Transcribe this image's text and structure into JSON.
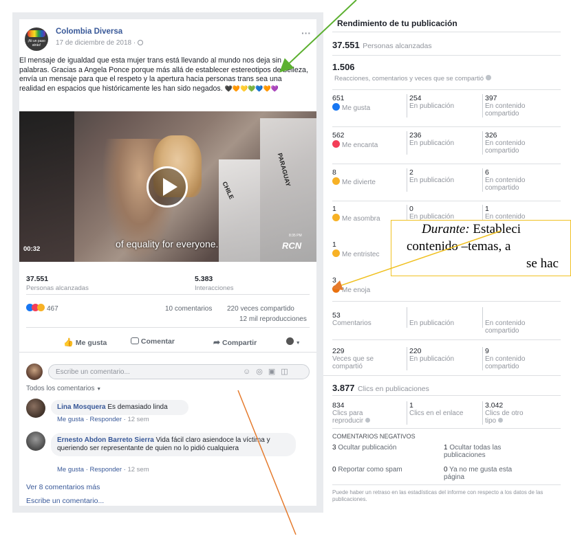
{
  "post": {
    "page_name": "Colombia Diversa",
    "avatar_text": "¡Ni un paso atrás!",
    "date": "17 de diciembre de 2018 · ",
    "more": "···",
    "text": "El mensaje de igualdad que esta mujer trans está llevando al mundo nos deja sin palabras. Gracias a Angela Ponce porque más allá de establecer estereotipos de belleza, envía un mensaje para que el respeto y la apertura hacia personas trans sea una realidad en espacios que históricamente les han sido negados.",
    "hearts": "🖤🧡💛💚💙🧡💜",
    "video": {
      "caption": "of equality for everyone.",
      "time": "00:32",
      "sash1": "CHILE",
      "sash2": "PARAGUAY",
      "logo": "RCN",
      "corner_time": "8:35 PM"
    },
    "reach_value": "37.551",
    "reach_label": "Personas alcanzadas",
    "interactions_value": "5.383",
    "interactions_label": "Interacciones",
    "reactions_count": "467",
    "comments_count": "10 comentarios",
    "shares_count": "220 veces compartido",
    "views": "12 mil reproducciones",
    "actions": {
      "like": "Me gusta",
      "comment": "Comentar",
      "share": "Compartir"
    },
    "comment_placeholder": "Escribe un comentario...",
    "filter": "Todos los comentarios",
    "comments": [
      {
        "author": "Lina Mosquera",
        "text": "Es demasiado linda",
        "meta_like": "Me gusta",
        "meta_reply": "Responder",
        "meta_time": "12 sem"
      },
      {
        "author": "Ernesto Abdon Barreto Sierra",
        "text": "Vida fácil claro asiendoce la víctima y queriendo ser representante de quien no lo pidió cualquiera",
        "meta_like": "Me gusta",
        "meta_reply": "Responder",
        "meta_time": "12 sem"
      }
    ],
    "more_comments": "Ver 8 comentarios más",
    "write_comment": "Escribe un comentario..."
  },
  "performance": {
    "title": "Rendimiento de tu publicación",
    "reach_value": "37.551",
    "reach_label": "Personas alcanzadas",
    "engagement_value": "1.506",
    "engagement_label": "Reacciones, comentarios y veces que se compartió",
    "rows": [
      {
        "total": "651",
        "label": "Me gusta",
        "on_post": "254",
        "on_post_label": "En publicación",
        "on_shared": "397",
        "on_shared_label": "En contenido compartido",
        "color": "#1877f2"
      },
      {
        "total": "562",
        "label": "Me encanta",
        "on_post": "236",
        "on_post_label": "En publicación",
        "on_shared": "326",
        "on_shared_label": "En contenido compartido",
        "color": "#f33e58"
      },
      {
        "total": "8",
        "label": "Me divierte",
        "on_post": "2",
        "on_post_label": "En publicación",
        "on_shared": "6",
        "on_shared_label": "En contenido compartido",
        "color": "#f7b125"
      },
      {
        "total": "1",
        "label": "Me asombra",
        "on_post": "0",
        "on_post_label": "En publicación",
        "on_shared": "1",
        "on_shared_label": "En contenido",
        "color": "#f7b125"
      },
      {
        "total": "1",
        "label": "Me entristec",
        "color": "#f7b125"
      },
      {
        "total": "3",
        "label": "Me enoja",
        "color": "#e9710f"
      },
      {
        "total": "53",
        "label": "Comentarios",
        "on_post_label": "En publicación",
        "on_shared_label": "En contenido compartido"
      },
      {
        "total": "229",
        "label": "Veces que se compartió",
        "on_post": "220",
        "on_post_label": "En publicación",
        "on_shared": "9",
        "on_shared_label": "En contenido compartido"
      }
    ],
    "clicks_value": "3.877",
    "clicks_label": "Clics en publicaciones",
    "clicks": [
      {
        "value": "834",
        "label": "Clics para reproducir"
      },
      {
        "value": "1",
        "label": "Clics en el enlace"
      },
      {
        "value": "3.042",
        "label": "Clics de otro tipo"
      }
    ],
    "negative_title": "COMENTARIOS NEGATIVOS",
    "negative": [
      {
        "value": "3",
        "label": "Ocultar publicación"
      },
      {
        "value": "1",
        "label": "Ocultar todas las publicaciones"
      },
      {
        "value": "0",
        "label": "Reportar como spam"
      },
      {
        "value": "0",
        "label": "Ya no me gusta esta página"
      }
    ],
    "footnote": "Puede haber un retraso en las estadísticas del informe con respecto a los datos de las publicaciones."
  },
  "overlay": {
    "line1_em": "Durante:",
    "line1": " Estableci",
    "line2": "contenido –temas, a",
    "line3": "se hac"
  },
  "colors": {
    "arrow_green": "#5cb030",
    "arrow_orange": "#e57a2c",
    "fb_blue": "#385898",
    "overlay_border": "#f0c020"
  }
}
